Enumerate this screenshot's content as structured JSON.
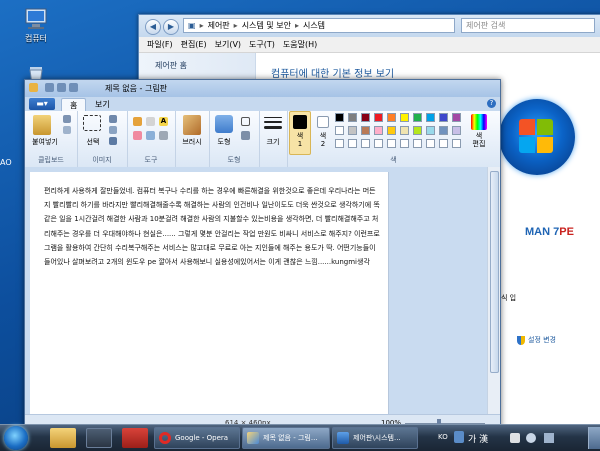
{
  "desktop": {
    "icons": [
      {
        "label": "컴퓨터",
        "icon": "computer-icon"
      },
      {
        "label": "",
        "icon": "recycle-bin-icon"
      }
    ],
    "edge_text": "AO"
  },
  "control_panel": {
    "breadcrumb": [
      "제어판",
      "시스템 및 보안",
      "시스템"
    ],
    "search_placeholder": "제어판 검색",
    "menu": [
      "파일(F)",
      "편집(E)",
      "보기(V)",
      "도구(T)",
      "도움말(H)"
    ],
    "left_home": "제어판 홈",
    "title": "컴퓨터에 대한 기본 정보 보기",
    "edition_logo_left": "MAN 7",
    "edition_logo_right": "PE",
    "info_fragment": "식 입",
    "setting_change": "설정 변경"
  },
  "paint": {
    "title": "제목 없음 - 그림판",
    "file_button": "▬▾",
    "tabs": [
      "홈",
      "보기"
    ],
    "help": "?",
    "groups": {
      "clipboard": {
        "label": "클립보드",
        "paste": "붙여넣기"
      },
      "image": {
        "label": "이미지",
        "select": "선택"
      },
      "tools": {
        "label": "도구"
      },
      "brushes": {
        "label": "브러시"
      },
      "shapes": {
        "label": "도형",
        "shapes_btn": "도형"
      },
      "size": {
        "label": "크기"
      },
      "colors": {
        "label": "색",
        "color1": "색\n1",
        "color2": "색\n2",
        "edit": "색\n편집"
      }
    },
    "palette": [
      "#000000",
      "#7f7f7f",
      "#880015",
      "#ed1c24",
      "#ff7f27",
      "#fff200",
      "#22b14c",
      "#00a2e8",
      "#3f48cc",
      "#a349a4",
      "#ffffff",
      "#c3c3c3",
      "#b97a57",
      "#ffaec9",
      "#ffc90e",
      "#efe4b0",
      "#b5e61d",
      "#99d9ea",
      "#7092be",
      "#c8bfe7"
    ],
    "canvas_text": "편리하게 사용하게 잘만들었네. 컴퓨터 복구나 수리를 하는 경우에 빠른해결을 위한것으로 좋은데 우리나라는 머든지 빨리빨리 하기를 바라지만 빨리해결해줄수록 해결하는 사람의 인건비나 일난이도도 더욱 싼것으로 생각하기에 똑같은 일을 1시간걸려 해결한 사람과 10분걸려 해결한 사람의 지불할수 있는비용을 생각하면, 더 빨리해결해주고 처리해주는 경우를 더 우대해야하나 현실은...... 그렇게 몇분 안걸리는 작업 만원도 비싸니 서비스로 해주지? 이런프로그램을 활용하여 간단히 수리복구해주는 서비스는 많고대로 무료로 아는 지인들에 해주는 용도가 딱. 어떤기능들이 들어있나 살펴보려고 2개의 윈도우 pe 깔아서 사용해보니 실용성에있어서는 이게 괜찮은 느낌......kungmi생각",
    "status": {
      "size": "614 × 460px",
      "zoom": "100%"
    }
  },
  "taskbar": {
    "buttons": [
      {
        "label": "Google - Opera",
        "icon": "opera-icon"
      },
      {
        "label": "제목 없음 - 그림...",
        "icon": "paint-icon"
      },
      {
        "label": "제어판\\시스템...",
        "icon": "control-panel-icon"
      }
    ],
    "tray": {
      "lang": "KO",
      "ime": "가 漢"
    }
  },
  "colors": {
    "accent": "#1e5a9e",
    "ribbon_bg": "#dbe7f5",
    "taskbar": "#243447"
  }
}
